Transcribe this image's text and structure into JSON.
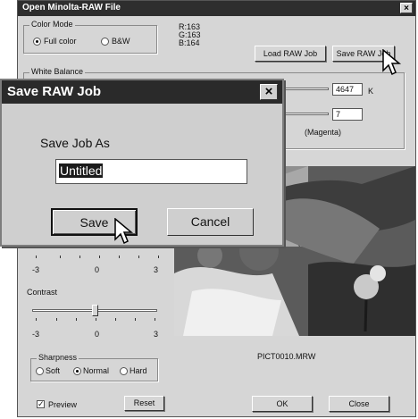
{
  "window": {
    "title": "Open Minolta-RAW File",
    "close_glyph": "×"
  },
  "color_mode": {
    "label": "Color Mode",
    "options": [
      "Full color",
      "B&W"
    ],
    "selected": "Full color",
    "readout": [
      "R:163",
      "G:163",
      "B:164"
    ]
  },
  "toolbar": {
    "load_label": "Load RAW Job",
    "save_label": "Save RAW Job"
  },
  "white_balance": {
    "label": "White Balance",
    "kelvin_value": "4647",
    "kelvin_unit": "K",
    "tint_value": "7",
    "tint_label": "(Magenta)"
  },
  "saturation": {
    "ticks": [
      "-3",
      "0",
      "3"
    ]
  },
  "contrast": {
    "label": "Contrast",
    "ticks": [
      "-3",
      "0",
      "3"
    ]
  },
  "sharpness": {
    "label": "Sharpness",
    "options": [
      "Soft",
      "Normal",
      "Hard"
    ],
    "selected": "Normal"
  },
  "preview": {
    "label": "Preview",
    "checked": true,
    "reset_label": "Reset"
  },
  "file_name": "PICT0010.MRW",
  "footer": {
    "ok_label": "OK",
    "close_label": "Close"
  },
  "dialog": {
    "title": "Save RAW Job",
    "prompt": "Save Job As",
    "input_value": "Untitled",
    "save_label": "Save",
    "cancel_label": "Cancel",
    "close_glyph": "×"
  }
}
